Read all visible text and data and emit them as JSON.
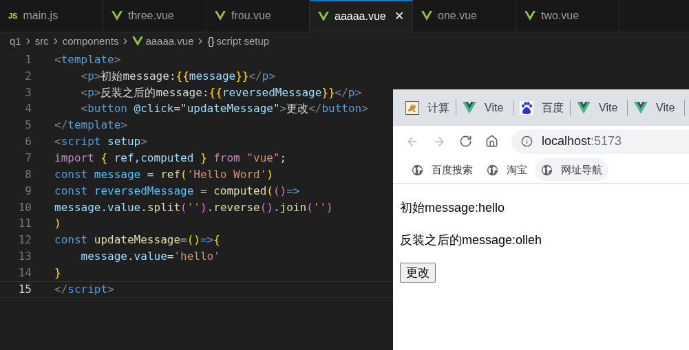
{
  "editor": {
    "tabs": [
      {
        "kind": "js",
        "badge": "JS",
        "label": "main.js",
        "selected": false
      },
      {
        "kind": "vue",
        "label": "three.vue",
        "selected": false
      },
      {
        "kind": "vue",
        "label": "frou.vue",
        "selected": false
      },
      {
        "kind": "vue",
        "label": "aaaaa.vue",
        "selected": true,
        "close": "✕"
      },
      {
        "kind": "vue",
        "label": "one.vue",
        "selected": false
      },
      {
        "kind": "vue",
        "label": "two.vue",
        "selected": false
      }
    ],
    "breadcrumbs": [
      {
        "kind": "plain",
        "label": "q1"
      },
      {
        "kind": "plain",
        "label": "src"
      },
      {
        "kind": "plain",
        "label": "components"
      },
      {
        "kind": "vue",
        "label": "aaaaa.vue"
      },
      {
        "kind": "symbol",
        "symbol": "{}",
        "label": "script setup"
      }
    ],
    "lines": [
      {
        "number": "1",
        "current": false,
        "tokens": [
          {
            "kind": "punct",
            "t": "<"
          },
          {
            "kind": "tag",
            "t": "template"
          },
          {
            "kind": "punct",
            "t": ">"
          }
        ]
      },
      {
        "number": "2",
        "current": false,
        "tokens": [
          {
            "kind": "punct",
            "t": "    <"
          },
          {
            "kind": "tag",
            "t": "p"
          },
          {
            "kind": "punct",
            "t": ">"
          },
          {
            "kind": "text",
            "t": "初始message:"
          },
          {
            "kind": "brace",
            "t": "{{"
          },
          {
            "kind": "var",
            "t": "message"
          },
          {
            "kind": "brace",
            "t": "}}"
          },
          {
            "kind": "punct",
            "t": "</"
          },
          {
            "kind": "tag",
            "t": "p"
          },
          {
            "kind": "punct",
            "t": ">"
          }
        ]
      },
      {
        "number": "3",
        "current": false,
        "tokens": [
          {
            "kind": "punct",
            "t": "    <"
          },
          {
            "kind": "tag",
            "t": "p"
          },
          {
            "kind": "punct",
            "t": ">"
          },
          {
            "kind": "text",
            "t": "反装之后的message:"
          },
          {
            "kind": "brace",
            "t": "{{"
          },
          {
            "kind": "var",
            "t": "reversedMessage"
          },
          {
            "kind": "brace",
            "t": "}}"
          },
          {
            "kind": "punct",
            "t": "</"
          },
          {
            "kind": "tag",
            "t": "p"
          },
          {
            "kind": "punct",
            "t": ">"
          }
        ]
      },
      {
        "number": "4",
        "current": false,
        "tokens": [
          {
            "kind": "punct",
            "t": "    <"
          },
          {
            "kind": "tag",
            "t": "button"
          },
          {
            "kind": "attr",
            "t": " @click"
          },
          {
            "kind": "text",
            "t": "=\""
          },
          {
            "kind": "var",
            "t": "updateMessage"
          },
          {
            "kind": "text",
            "t": "\""
          },
          {
            "kind": "punct",
            "t": ">"
          },
          {
            "kind": "text",
            "t": "更改"
          },
          {
            "kind": "punct",
            "t": "</"
          },
          {
            "kind": "tag",
            "t": "button"
          },
          {
            "kind": "punct",
            "t": ">"
          }
        ]
      },
      {
        "number": "5",
        "current": false,
        "tokens": [
          {
            "kind": "punct",
            "t": "</"
          },
          {
            "kind": "tag",
            "t": "template"
          },
          {
            "kind": "punct",
            "t": ">"
          }
        ]
      },
      {
        "number": "6",
        "current": false,
        "tokens": [
          {
            "kind": "punct",
            "t": "<"
          },
          {
            "kind": "tag",
            "t": "script"
          },
          {
            "kind": "attr",
            "t": " setup"
          },
          {
            "kind": "punct",
            "t": ">"
          }
        ]
      },
      {
        "number": "7",
        "current": false,
        "tokens": [
          {
            "kind": "control",
            "t": "import"
          },
          {
            "kind": "brace",
            "t": " {"
          },
          {
            "kind": "var",
            "t": " ref,computed "
          },
          {
            "kind": "brace",
            "t": "}"
          },
          {
            "kind": "control",
            "t": " from"
          },
          {
            "kind": "string",
            "t": " \"vue\""
          },
          {
            "kind": "text",
            "t": ";"
          }
        ]
      },
      {
        "number": "8",
        "current": false,
        "tokens": [
          {
            "kind": "tag",
            "t": "const"
          },
          {
            "kind": "const",
            "t": " message"
          },
          {
            "kind": "text",
            "t": " = "
          },
          {
            "kind": "func",
            "t": "ref"
          },
          {
            "kind": "brace",
            "t": "("
          },
          {
            "kind": "string",
            "t": "'Hello Word'"
          },
          {
            "kind": "brace",
            "t": ")"
          }
        ]
      },
      {
        "number": "9",
        "current": false,
        "tokens": [
          {
            "kind": "tag",
            "t": "const"
          },
          {
            "kind": "const",
            "t": " reversedMessage"
          },
          {
            "kind": "text",
            "t": " = "
          },
          {
            "kind": "func",
            "t": "computed"
          },
          {
            "kind": "brace",
            "t": "("
          },
          {
            "kind": "paren",
            "t": "()"
          },
          {
            "kind": "tag",
            "t": "=>"
          }
        ]
      },
      {
        "number": "10",
        "current": false,
        "tokens": [
          {
            "kind": "var",
            "t": "message"
          },
          {
            "kind": "text",
            "t": "."
          },
          {
            "kind": "var",
            "t": "value"
          },
          {
            "kind": "text",
            "t": "."
          },
          {
            "kind": "func",
            "t": "split"
          },
          {
            "kind": "paren",
            "t": "("
          },
          {
            "kind": "string",
            "t": "''"
          },
          {
            "kind": "paren",
            "t": ")"
          },
          {
            "kind": "text",
            "t": "."
          },
          {
            "kind": "func",
            "t": "reverse"
          },
          {
            "kind": "paren",
            "t": "()"
          },
          {
            "kind": "text",
            "t": "."
          },
          {
            "kind": "func",
            "t": "join"
          },
          {
            "kind": "paren",
            "t": "("
          },
          {
            "kind": "string",
            "t": "''"
          },
          {
            "kind": "paren",
            "t": ")"
          }
        ]
      },
      {
        "number": "11",
        "current": false,
        "tokens": [
          {
            "kind": "brace",
            "t": ")"
          }
        ]
      },
      {
        "number": "12",
        "current": false,
        "tokens": [
          {
            "kind": "tag",
            "t": "const"
          },
          {
            "kind": "func",
            "t": " updateMessage"
          },
          {
            "kind": "text",
            "t": "="
          },
          {
            "kind": "brace",
            "t": "()"
          },
          {
            "kind": "tag",
            "t": "=>"
          },
          {
            "kind": "brace",
            "t": "{"
          }
        ]
      },
      {
        "number": "13",
        "current": false,
        "tokens": [
          {
            "kind": "var",
            "t": "    message"
          },
          {
            "kind": "text",
            "t": "."
          },
          {
            "kind": "var",
            "t": "value"
          },
          {
            "kind": "text",
            "t": "="
          },
          {
            "kind": "string",
            "t": "'hello'"
          }
        ]
      },
      {
        "number": "14",
        "current": false,
        "tokens": [
          {
            "kind": "brace",
            "t": "}"
          }
        ]
      },
      {
        "number": "15",
        "current": true,
        "tokens": [
          {
            "kind": "punct",
            "t": "</"
          },
          {
            "kind": "tag",
            "t": "script"
          },
          {
            "kind": "punct",
            "t": ">"
          }
        ]
      }
    ]
  },
  "browser": {
    "tabs": [
      {
        "kind": "cat",
        "title": "计算"
      },
      {
        "kind": "vue",
        "title": "Vite"
      },
      {
        "kind": "paw",
        "title": "百度"
      },
      {
        "kind": "vue",
        "title": "Vite"
      },
      {
        "kind": "vue",
        "title": "Vite"
      }
    ],
    "address": {
      "host": "localhost",
      "port": ":5173"
    },
    "bookmarks": [
      {
        "label": "百度搜索",
        "selected": false
      },
      {
        "label": "淘宝",
        "selected": false
      },
      {
        "label": "网址导航",
        "selected": true
      }
    ],
    "page": {
      "paragraphs": [
        "初始message:hello",
        "反装之后的message:olleh"
      ],
      "button": "更改"
    }
  }
}
